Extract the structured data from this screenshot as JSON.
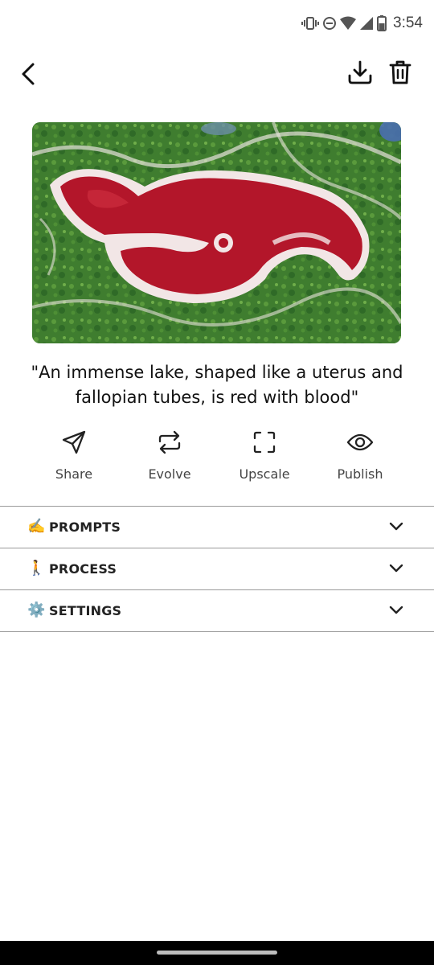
{
  "status_bar": {
    "time": "3:54",
    "icons": [
      "vibrate-icon",
      "do-not-disturb-icon",
      "wifi-icon",
      "signal-icon",
      "battery-icon"
    ]
  },
  "top_bar": {
    "icons": [
      "back-arrow-icon",
      "download-icon",
      "trash-icon"
    ]
  },
  "image": {
    "colors": {
      "grass": "#3f7d2f",
      "lake": "#b3162a",
      "salt": "#f2e6e6"
    }
  },
  "caption": {
    "text": "\"An immense lake, shaped like a uterus and fallopian tubes, is red with blood\""
  },
  "actions": [
    {
      "label": "Share",
      "icon": "send-icon"
    },
    {
      "label": "Evolve",
      "icon": "repeat-icon"
    },
    {
      "label": "Upscale",
      "icon": "expand-frame-icon"
    },
    {
      "label": "Publish",
      "icon": "eye-icon"
    }
  ],
  "sections": [
    {
      "emoji": "✍️",
      "title": "PROMPTS"
    },
    {
      "emoji": "🚶",
      "title": "PROCESS"
    },
    {
      "emoji": "⚙️",
      "title": "SETTINGS"
    }
  ]
}
